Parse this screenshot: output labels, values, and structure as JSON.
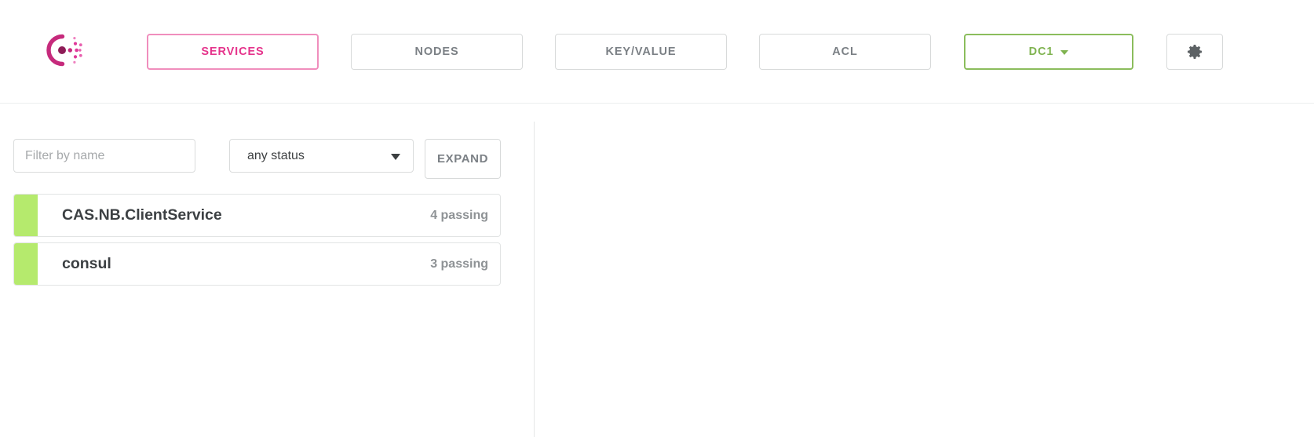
{
  "header": {
    "logo_name": "consul-logo",
    "nav": [
      {
        "id": "services",
        "label": "SERVICES",
        "state": "active"
      },
      {
        "id": "nodes",
        "label": "NODES",
        "state": "default"
      },
      {
        "id": "kv",
        "label": "KEY/VALUE",
        "state": "default"
      },
      {
        "id": "acl",
        "label": "ACL",
        "state": "default"
      }
    ],
    "datacenter": {
      "label": "DC1",
      "caret": "chevron-down-icon"
    },
    "settings": {
      "icon": "gear-icon"
    }
  },
  "filters": {
    "name_filter": {
      "value": "",
      "placeholder": "Filter by name"
    },
    "status_select": {
      "selected": "any status",
      "caret": "caret-down-icon"
    },
    "expand_button": "EXPAND"
  },
  "services": [
    {
      "name": "CAS.NB.ClientService",
      "status": "4 passing",
      "health_color": "#b5ea6d"
    },
    {
      "name": "consul",
      "status": "3 passing",
      "health_color": "#b5ea6d"
    }
  ],
  "colors": {
    "brand_pink": "#e5338b",
    "brand_pink_border": "#f08ebd",
    "dc_green": "#7fb350",
    "passing_green": "#b5ea6d",
    "muted_text": "#7b8085",
    "border": "#d8dada"
  }
}
